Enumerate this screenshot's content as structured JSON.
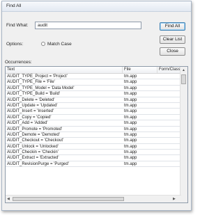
{
  "window": {
    "title": "Find All"
  },
  "search": {
    "label": "Find What:",
    "value": "audit"
  },
  "options": {
    "label": "Options:",
    "match_case": "Match Case",
    "match_case_checked": false
  },
  "buttons": {
    "find_all": "Find All",
    "clear_list": "Clear List",
    "close": "Close"
  },
  "occurrences": {
    "label": "Occurrences:",
    "columns": [
      "Text",
      "File",
      "Form/Class"
    ],
    "rows": [
      [
        "AUDIT_TYPE_Project = 'Project'",
        "tm.app",
        ""
      ],
      [
        "AUDIT_TYPE_File = 'File'",
        "tm.app",
        ""
      ],
      [
        "AUDIT_TYPE_Model = 'Data Model'",
        "tm.app",
        ""
      ],
      [
        "AUDIT_TYPE_Build = 'Build'",
        "tm.app",
        ""
      ],
      [
        "AUDIT_Delete = 'Deleted'",
        "tm.app",
        ""
      ],
      [
        "AUDIT_Update = 'Updated'",
        "tm.app",
        ""
      ],
      [
        "AUDIT_Insert = 'Inserted'",
        "tm.app",
        ""
      ],
      [
        "AUDIT_Copy = 'Copied'",
        "tm.app",
        ""
      ],
      [
        "AUDIT_Add = 'Added'",
        "tm.app",
        ""
      ],
      [
        "AUDIT_Promote = 'Promoted'",
        "tm.app",
        ""
      ],
      [
        "AUDIT_Demote = 'Demoted'",
        "tm.app",
        ""
      ],
      [
        "AUDIT_Checkout = 'Checkout'",
        "tm.app",
        ""
      ],
      [
        "AUDIT_Unlock = 'Unlocked'",
        "tm.app",
        ""
      ],
      [
        "AUDIT_Checkin = 'Checkin'",
        "tm.app",
        ""
      ],
      [
        "AUDIT_Extract = 'Extracted'",
        "tm.app",
        ""
      ],
      [
        "AUDIT_RevisionPurge = 'Purged'",
        "tm.app",
        ""
      ]
    ]
  }
}
